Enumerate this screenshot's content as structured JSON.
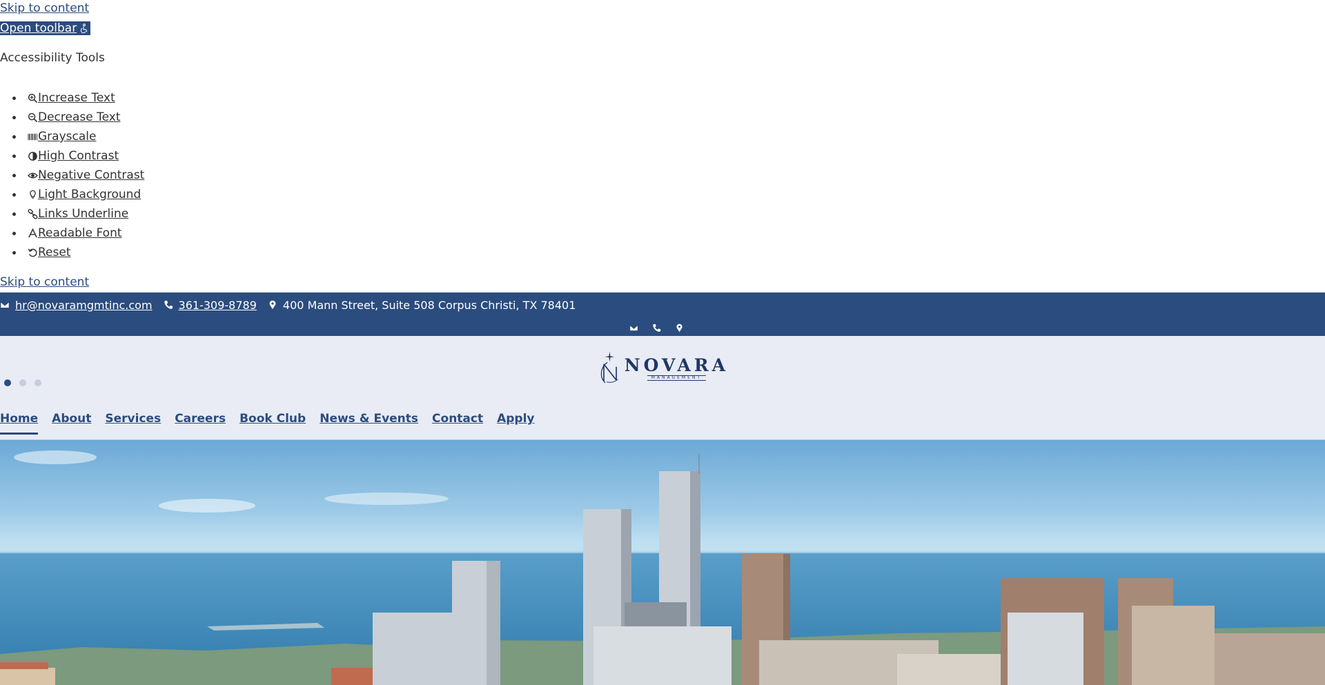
{
  "skip_link_top": "Skip to content",
  "open_toolbar": {
    "label": "Open toolbar"
  },
  "accessibility": {
    "title": "Accessibility Tools",
    "items": [
      {
        "label": "Increase Text",
        "icon": "zoom-in-icon"
      },
      {
        "label": "Decrease Text",
        "icon": "zoom-out-icon"
      },
      {
        "label": "Grayscale",
        "icon": "barcode-icon"
      },
      {
        "label": "High Contrast",
        "icon": "contrast-icon"
      },
      {
        "label": "Negative Contrast",
        "icon": "eye-icon"
      },
      {
        "label": "Light Background",
        "icon": "lightbulb-icon"
      },
      {
        "label": "Links Underline",
        "icon": "link-icon"
      },
      {
        "label": "Readable Font",
        "icon": "font-icon"
      },
      {
        "label": "Reset",
        "icon": "reset-icon"
      }
    ]
  },
  "skip_link_bottom": "Skip to content",
  "topbar": {
    "email": "hr@novaramgmtinc.com",
    "phone": "361-309-8789",
    "address": "400 Mann Street, Suite 508 Corpus Christi, TX 78401"
  },
  "logo": {
    "brand": "NOVARA",
    "sub": "MANAGEMENT"
  },
  "slider": {
    "dots": 3,
    "active": 0
  },
  "nav": [
    "Home",
    "About",
    "Services",
    "Careers",
    "Book Club",
    "News & Events",
    "Contact",
    "Apply"
  ],
  "colors": {
    "brand_navy": "#2b4c7e",
    "header_bg": "#e9ecf5",
    "sea": "#3d86b6",
    "sky": "#9fcbe8"
  }
}
